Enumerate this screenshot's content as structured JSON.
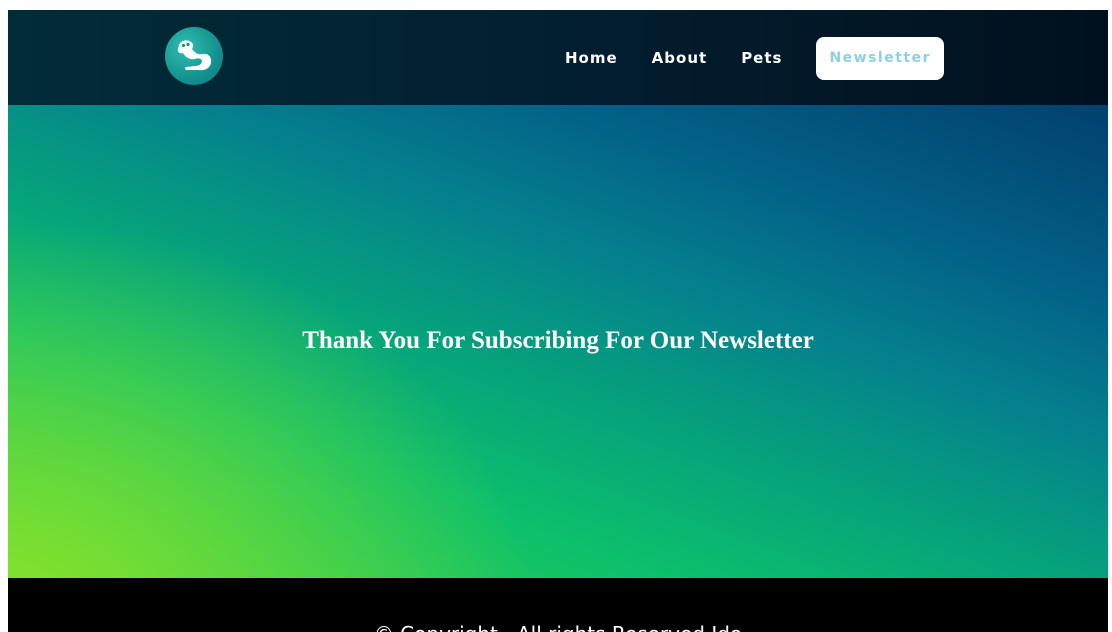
{
  "header": {
    "logo_icon": "ferret-icon",
    "nav": {
      "home": "Home",
      "about": "About",
      "pets": "Pets",
      "newsletter": "Newsletter"
    }
  },
  "hero": {
    "title": "Thank You For Subscribing For Our Newsletter"
  },
  "footer": {
    "copyright": "© Copyright . All rights Reserved.Ido"
  },
  "colors": {
    "header_bg": "#022c38",
    "hero_gradient_start": "#86e12c",
    "hero_gradient_end": "#02416e",
    "footer_bg": "#000000",
    "newsletter_text": "#8fd0e0"
  }
}
